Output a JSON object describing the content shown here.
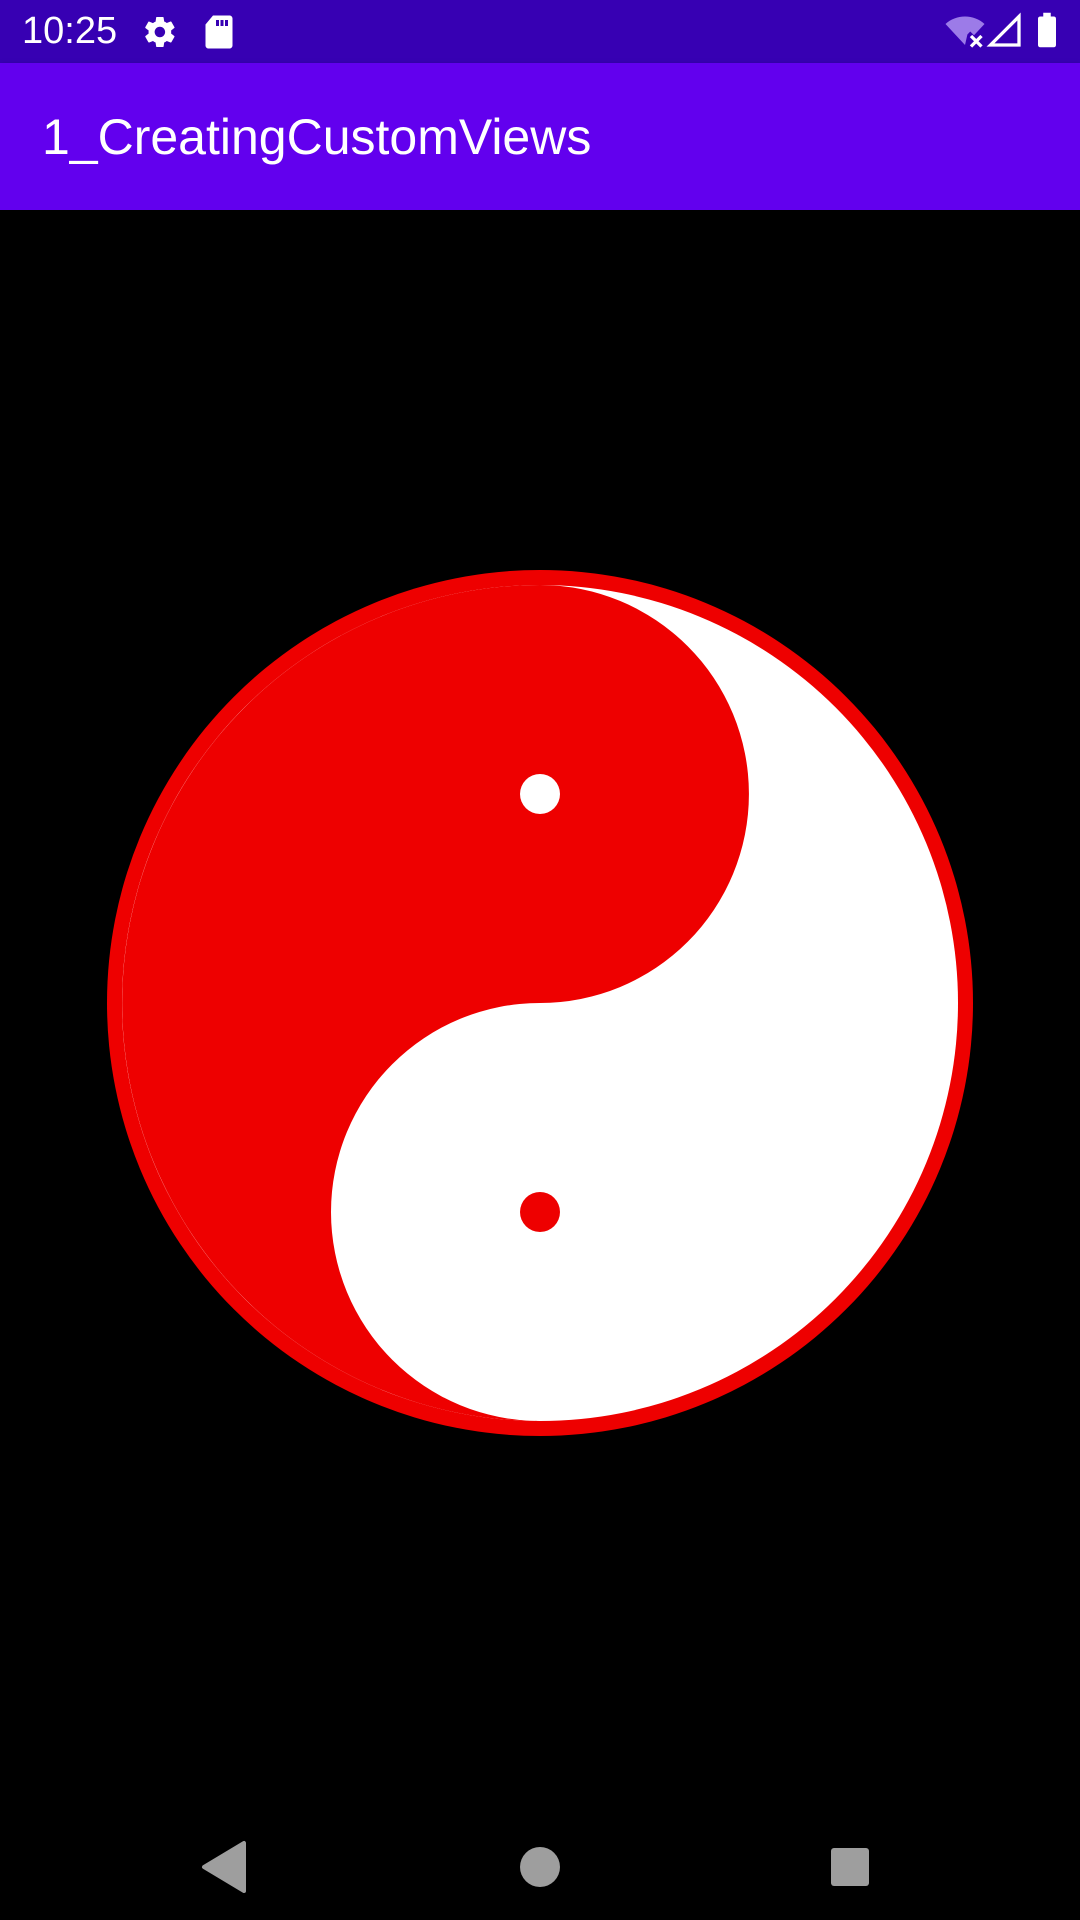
{
  "status_bar": {
    "time": "10:25",
    "icons": [
      "gear-icon",
      "sd-card-icon",
      "wifi-off-icon",
      "signal-icon",
      "battery-icon"
    ],
    "color": "#3700B3"
  },
  "app_bar": {
    "title": "1_CreatingCustomViews",
    "color": "#6200EE"
  },
  "custom_view": {
    "name": "yin-yang",
    "primary_color": "#EE0000",
    "secondary_color": "#FFFFFF",
    "background_color": "#000000"
  },
  "navigation_bar": {
    "buttons": [
      "back",
      "home",
      "recents"
    ],
    "icon_color": "#9E9E9E"
  }
}
